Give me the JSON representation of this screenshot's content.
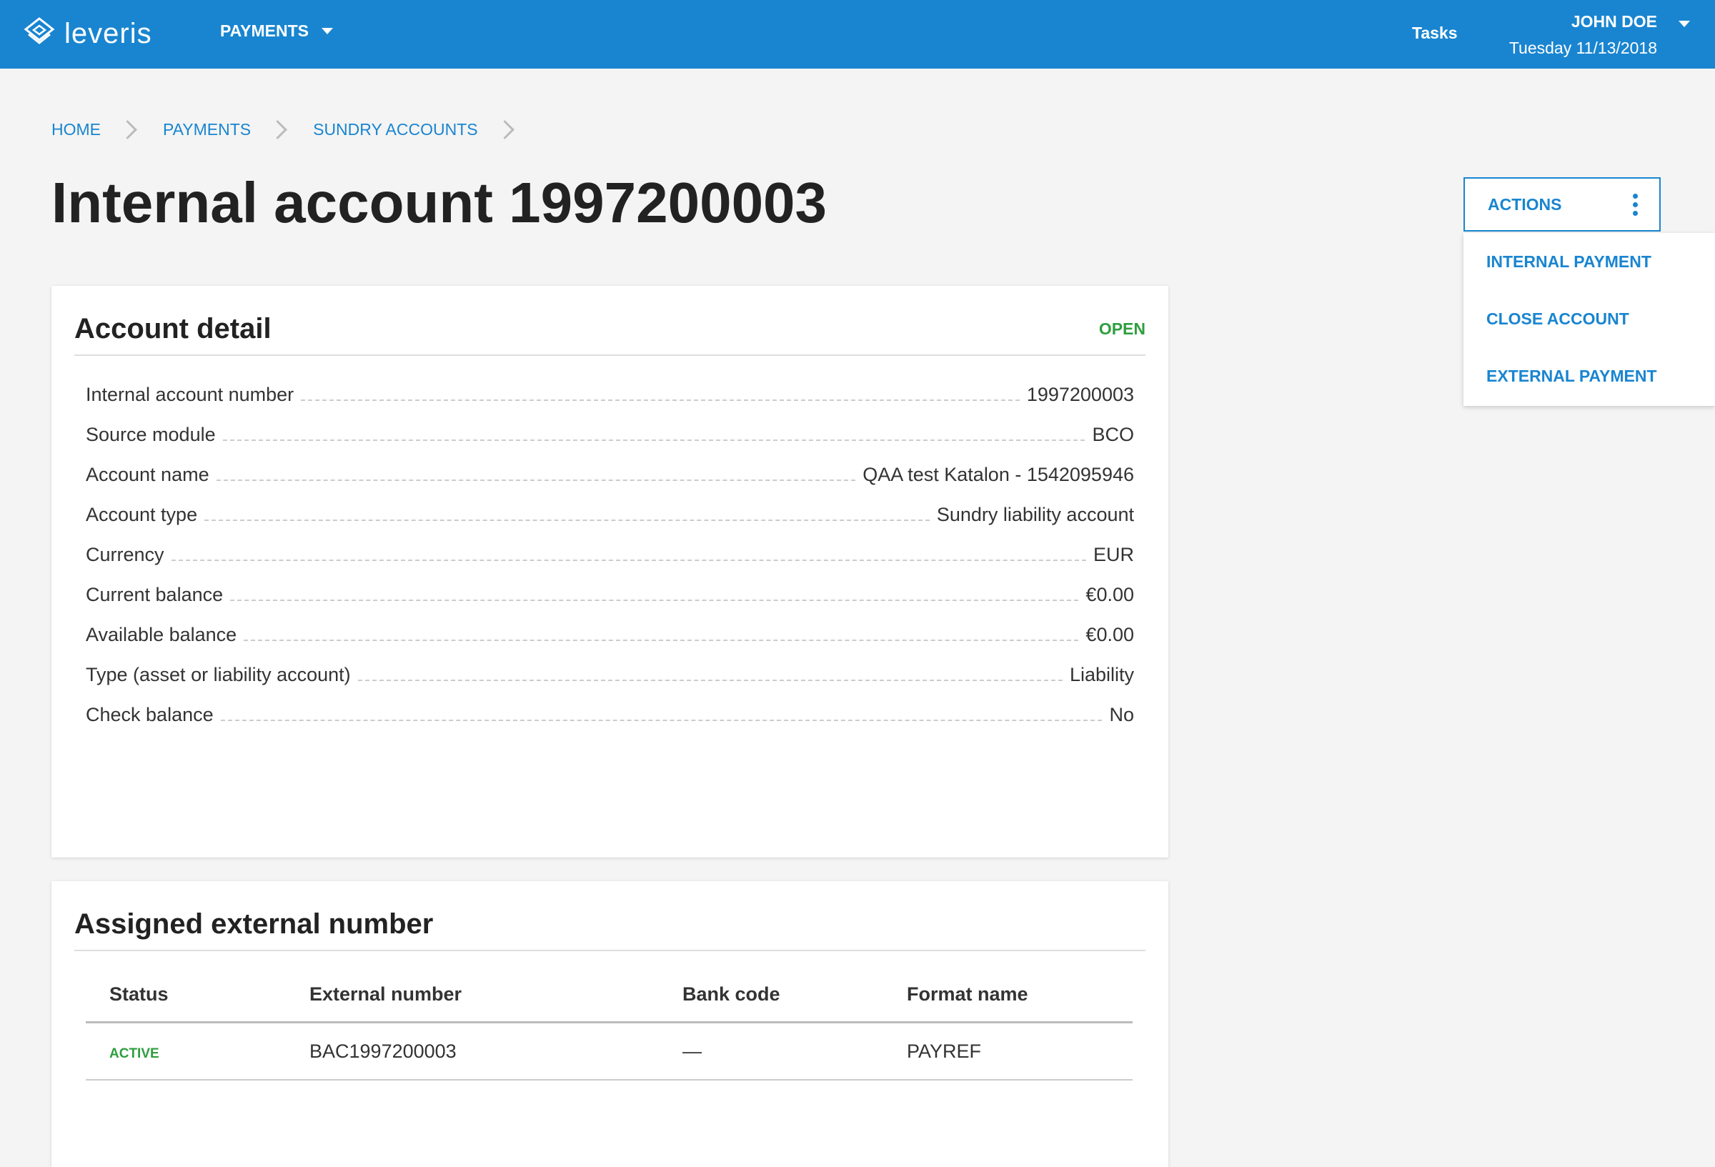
{
  "app": {
    "logo_text": "leveris",
    "nav_menu_label": "PAYMENTS",
    "tasks_label": "Tasks",
    "user_name": "JOHN DOE",
    "user_date": "Tuesday 11/13/2018",
    "brand_color": "#1985d0",
    "status_green": "#2e9e3e"
  },
  "breadcrumb": [
    "HOME",
    "PAYMENTS",
    "SUNDRY ACCOUNTS"
  ],
  "page_title": "Internal account 1997200003",
  "actions": {
    "label": "ACTIONS",
    "items": [
      "INTERNAL PAYMENT",
      "CLOSE ACCOUNT",
      "EXTERNAL PAYMENT"
    ]
  },
  "account_detail": {
    "title": "Account detail",
    "status": "OPEN",
    "rows": [
      {
        "label": "Internal account number",
        "value": "1997200003"
      },
      {
        "label": "Source module",
        "value": "BCO"
      },
      {
        "label": "Account name",
        "value": "QAA test Katalon - 1542095946"
      },
      {
        "label": "Account type",
        "value": "Sundry liability account"
      },
      {
        "label": "Currency",
        "value": "EUR"
      },
      {
        "label": "Current balance",
        "value": "€0.00"
      },
      {
        "label": "Available balance",
        "value": "€0.00"
      },
      {
        "label": "Type (asset or liability account)",
        "value": "Liability"
      },
      {
        "label": "Check balance",
        "value": "No"
      }
    ]
  },
  "external_numbers": {
    "title": "Assigned external number",
    "columns": [
      "Status",
      "External number",
      "Bank code",
      "Format name"
    ],
    "rows": [
      {
        "status": "ACTIVE",
        "external_number": "BAC1997200003",
        "bank_code": "—",
        "format_name": "PAYREF"
      }
    ]
  }
}
